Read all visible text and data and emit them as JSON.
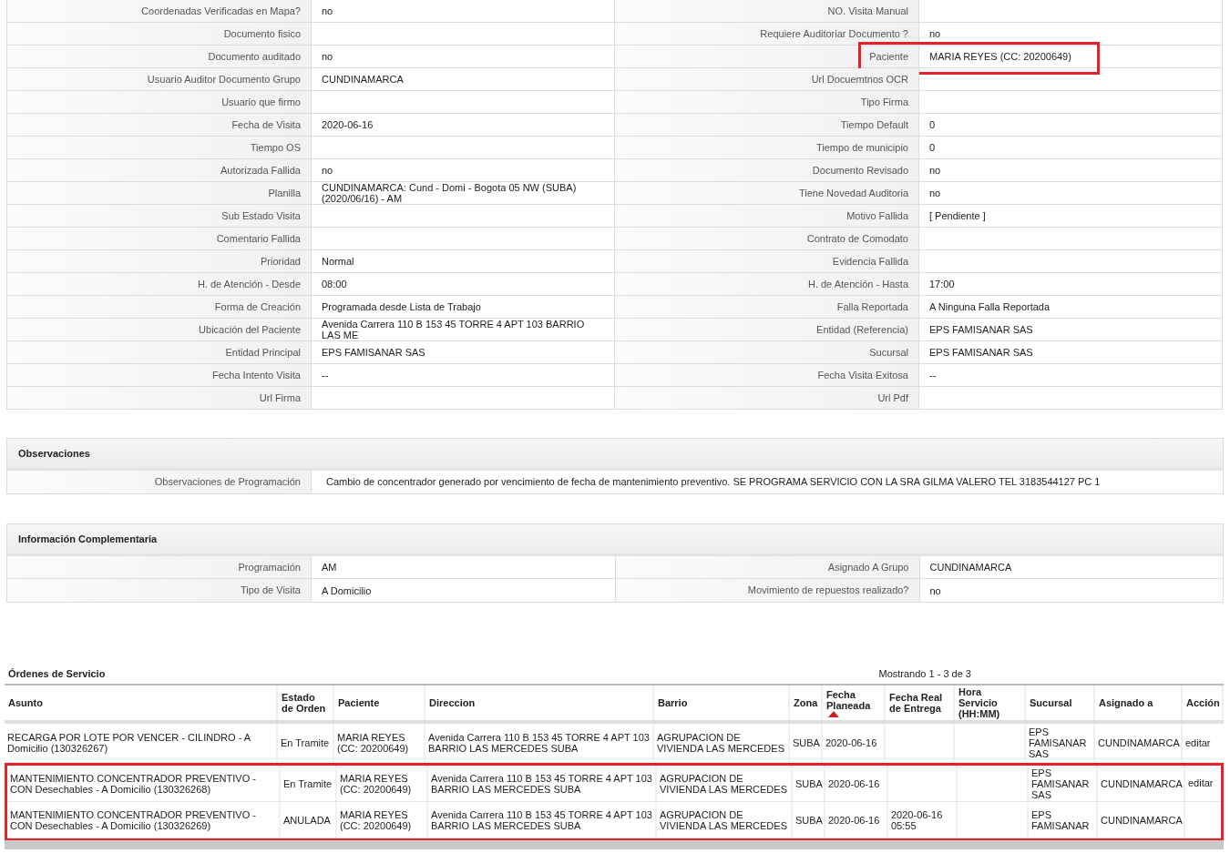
{
  "details": {
    "rows": [
      {
        "left": {
          "label": "Coordenadas Verificadas en Mapa?",
          "value": "no",
          "highlighted": false
        },
        "right": {
          "label": "NO. Visita Manual",
          "highlighted": false
        }
      },
      {
        "left": {
          "label": "Documento fisico",
          "highlighted": false
        },
        "right": {
          "label": "Requiere Auditoriar Documento ?",
          "value": "no",
          "highlighted": false
        }
      },
      {
        "left": {
          "label": "Documento auditado",
          "value": "no",
          "highlighted": false
        },
        "right": {
          "label": "Paciente",
          "value": "MARIA REYES (CC: 20200649)",
          "highlighted": true
        }
      },
      {
        "left": {
          "label": "Usuario Auditor Documento Grupo",
          "value": "CUNDINAMARCA",
          "highlighted": false
        },
        "right": {
          "label": "Url Docuemtnos OCR",
          "highlighted": false
        }
      },
      {
        "left": {
          "label": "Usuario que firmo",
          "highlighted": false
        },
        "right": {
          "label": "Tipo Firma",
          "highlighted": false
        }
      },
      {
        "left": {
          "label": "Fecha de Visita",
          "value": "2020-06-16",
          "highlighted": false
        },
        "right": {
          "label": "Tiempo Default",
          "value": "0",
          "highlighted": false
        }
      },
      {
        "left": {
          "label": "Tiempo OS",
          "highlighted": false
        },
        "right": {
          "label": "Tiempo de municipio",
          "value": "0",
          "highlighted": false
        }
      },
      {
        "left": {
          "label": "Autorizada Fallida",
          "value": "no",
          "highlighted": false
        },
        "right": {
          "label": "Documento Revisado",
          "value": "no",
          "highlighted": false
        }
      },
      {
        "left": {
          "label": "Planilla",
          "value": "CUNDINAMARCA: Cund - Domi - Bogota 05 NW (SUBA) (2020/06/16) - AM",
          "highlighted": false
        },
        "right": {
          "label": "Tiene Novedad Auditoria",
          "value": "no",
          "highlighted": false
        }
      },
      {
        "left": {
          "label": "Sub Estado Visita",
          "highlighted": false
        },
        "right": {
          "label": "Motivo Fallida",
          "value": "[ Pendiente ]",
          "highlighted": false
        }
      },
      {
        "left": {
          "label": "Comentario Fallida",
          "highlighted": false
        },
        "right": {
          "label": "Contrato de Comodato",
          "highlighted": false
        }
      },
      {
        "left": {
          "label": "Prioridad",
          "value": "Normal",
          "highlighted": false
        },
        "right": {
          "label": "Evidencia Fallida",
          "highlighted": false
        }
      },
      {
        "left": {
          "label": "H. de Atención - Desde",
          "value": "08:00",
          "highlighted": false
        },
        "right": {
          "label": "H. de Atención - Hasta",
          "value": "17:00",
          "highlighted": false
        }
      },
      {
        "left": {
          "label": "Forma de Creación",
          "value": "Programada desde Lista de Trabajo",
          "highlighted": false
        },
        "right": {
          "label": "Falla Reportada",
          "value": "A Ninguna Falla Reportada",
          "highlighted": false
        }
      },
      {
        "left": {
          "label": "Ubicación del Paciente",
          "value": "Avenida Carrera 110 B 153 45 TORRE 4 APT 103 BARRIO LAS ME",
          "highlighted": false
        },
        "right": {
          "label": "Entidad (Referencia)",
          "value": "EPS FAMISANAR SAS",
          "highlighted": false
        }
      },
      {
        "left": {
          "label": "Entidad Principal",
          "value": "EPS FAMISANAR SAS",
          "highlighted": false
        },
        "right": {
          "label": "Sucursal",
          "value": "EPS FAMISANAR SAS",
          "highlighted": false
        }
      },
      {
        "left": {
          "label": "Fecha Intento Visita",
          "value": "--",
          "highlighted": false
        },
        "right": {
          "label": "Fecha Visita Exitosa",
          "value": "--",
          "highlighted": false
        }
      },
      {
        "left": {
          "label": "Url Firma",
          "highlighted": false
        },
        "right": {
          "label": "Url Pdf",
          "highlighted": false
        }
      }
    ]
  },
  "observaciones": {
    "title": "Observaciones",
    "rows": [
      {
        "label": "Observaciones de Programación",
        "value": "Cambio de concentrador generado por vencimiento de fecha de mantenimiento preventivo. SE PROGRAMA SERVICIO CON LA SRA GILMA VALERO TEL 3183544127 PC 1"
      }
    ]
  },
  "complementaria": {
    "title": "Información Complementaria",
    "rows": [
      {
        "left": {
          "label": "Programación",
          "value": "AM"
        },
        "right": {
          "label": "Asignado A Grupo",
          "value": "CUNDINAMARCA"
        }
      },
      {
        "left": {
          "label": "Tipo de Visita",
          "value": "A Domicilio"
        },
        "right": {
          "label": "Movimiento de repuestos realizado?",
          "value": "no"
        }
      }
    ]
  },
  "ordenes": {
    "title": "Órdenes de Servicio",
    "pager": "Mostrando 1 - 3 de 3",
    "columns": [
      {
        "label": "Asunto",
        "sorted": false
      },
      {
        "label": "Estado de Orden",
        "sorted": false
      },
      {
        "label": "Paciente",
        "sorted": false
      },
      {
        "label": "Direccion",
        "sorted": false
      },
      {
        "label": "Barrio",
        "sorted": false
      },
      {
        "label": "Zona",
        "sorted": false
      },
      {
        "label": "Fecha Planeada",
        "sorted": true
      },
      {
        "label": "Fecha Real de Entrega",
        "sorted": false
      },
      {
        "label": "Hora Servicio (HH:MM)",
        "sorted": false
      },
      {
        "label": "Sucursal",
        "sorted": false
      },
      {
        "label": "Asignado a",
        "sorted": false
      },
      {
        "label": "Acción",
        "sorted": false
      }
    ],
    "rows": [
      {
        "highlighted": false,
        "action": "editar",
        "cells": [
          "RECARGA POR LOTE POR VENCER - CILINDRO - A Domicilio (130326267)",
          "En Tramite",
          "MARIA REYES (CC: 20200649)",
          "Avenida Carrera 110 B 153 45 TORRE 4 APT 103 BARRIO LAS MERCEDES SUBA",
          "AGRUPACION DE VIVIENDA LAS MERCEDES",
          "SUBA",
          "2020-06-16",
          null,
          null,
          "EPS FAMISANAR SAS",
          "CUNDINAMARCA"
        ]
      },
      {
        "highlighted": true,
        "action": "editar",
        "cells": [
          "MANTENIMIENTO CONCENTRADOR PREVENTIVO - CON Desechables - A Domicilio (130326268)",
          "En Tramite",
          "MARIA REYES (CC: 20200649)",
          "Avenida Carrera 110 B 153 45 TORRE 4 APT 103 BARRIO LAS MERCEDES SUBA",
          "AGRUPACION DE VIVIENDA LAS MERCEDES",
          "SUBA",
          "2020-06-16",
          null,
          null,
          "EPS FAMISANAR SAS",
          "CUNDINAMARCA"
        ]
      },
      {
        "highlighted": true,
        "cells": [
          "MANTENIMIENTO CONCENTRADOR PREVENTIVO - CON Desechables - A Domicilio (130326269)",
          "ANULADA",
          "MARIA REYES (CC: 20200649)",
          "Avenida Carrera 110 B 153 45 TORRE 4 APT 103 BARRIO LAS MERCEDES SUBA",
          "AGRUPACION DE VIVIENDA LAS MERCEDES",
          "SUBA",
          "2020-06-16",
          "2020-06-16 05:55",
          null,
          "EPS FAMISANAR",
          "CUNDINAMARCA"
        ]
      }
    ]
  }
}
